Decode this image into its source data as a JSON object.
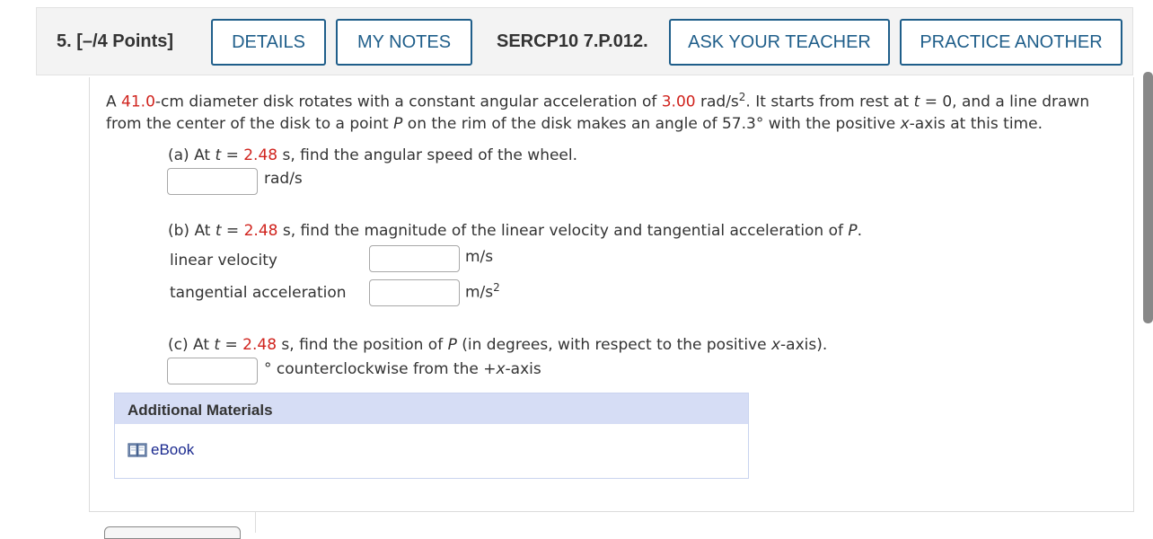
{
  "header": {
    "question_number": "5.",
    "points": "[–/4 Points]",
    "details_label": "DETAILS",
    "my_notes_label": "MY NOTES",
    "question_code": "SERCP10 7.P.012.",
    "ask_teacher_label": "ASK YOUR TEACHER",
    "practice_label": "PRACTICE ANOTHER"
  },
  "problem": {
    "intro": {
      "p1": "A ",
      "diameter": "41.0",
      "p2": "-cm diameter disk rotates with a constant angular acceleration of ",
      "accel": "3.00",
      "p3": " rad/s",
      "p3_sup": "2",
      "p4": ". It starts from rest at ",
      "t_var": "t",
      "p5": " = 0, and a line drawn",
      "l2a": "from the center of the disk to a point ",
      "p_var": "P",
      "l2b": " on the rim of the disk makes an angle of 57.3° with the positive ",
      "x_var": "x",
      "l2c": "-axis at this time."
    },
    "part_a": {
      "prefix": "(a) At ",
      "t_var": "t",
      "eq": " = ",
      "t_value": "2.48",
      "suffix": " s, find the angular speed of the wheel.",
      "unit": "rad/s",
      "answer": ""
    },
    "part_b": {
      "prefix": "(b) At ",
      "t_var": "t",
      "eq": " = ",
      "t_value": "2.48",
      "suffix": " s, find the magnitude of the linear velocity and tangential acceleration of ",
      "p_var": "P",
      "end": ".",
      "lv_label": "linear velocity",
      "lv_unit": "m/s",
      "lv_answer": "",
      "ta_label": "tangential acceleration",
      "ta_unit": "m/s",
      "ta_unit_sup": "2",
      "ta_answer": ""
    },
    "part_c": {
      "prefix": "(c) At ",
      "t_var": "t",
      "eq": " = ",
      "t_value": "2.48",
      "suffix": " s, find the position of ",
      "p_var": "P",
      "suffix2": " (in degrees, with respect to the positive ",
      "x_var": "x",
      "suffix3": "-axis).",
      "unit_a": "° counterclockwise from the +",
      "unit_x": "x",
      "unit_b": "-axis",
      "answer": ""
    }
  },
  "additional": {
    "title": "Additional Materials",
    "ebook_label": "eBook"
  },
  "colors": {
    "accent": "#1f5e8a",
    "given_value": "#d0231d",
    "materials_header": "#d6ddf5",
    "link": "#1b2a8f"
  }
}
